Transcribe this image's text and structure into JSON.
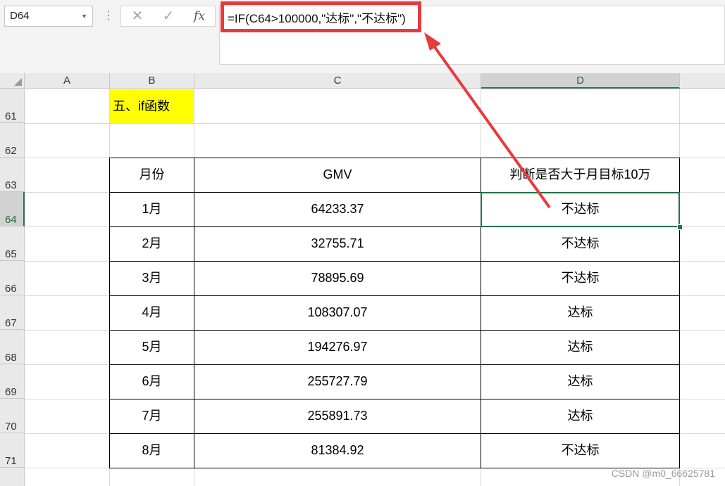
{
  "name_box": {
    "value": "D64"
  },
  "formula_bar": {
    "cancel_icon": "✕",
    "confirm_icon": "✓",
    "fx_label": "fx",
    "formula": "=IF(C64>100000,\"达标\",\"不达标\")"
  },
  "columns": [
    "A",
    "B",
    "C",
    "D"
  ],
  "rows": [
    "61",
    "62",
    "63",
    "64",
    "65",
    "66",
    "67",
    "68",
    "69",
    "70",
    "71"
  ],
  "selected_cell": "D64",
  "section_title": "五、if函数",
  "table": {
    "headers": [
      "月份",
      "GMV",
      "判断是否大于月目标10万"
    ],
    "rows": [
      {
        "month": "1月",
        "gmv": "64233.37",
        "result": "不达标"
      },
      {
        "month": "2月",
        "gmv": "32755.71",
        "result": "不达标"
      },
      {
        "month": "3月",
        "gmv": "78895.69",
        "result": "不达标"
      },
      {
        "month": "4月",
        "gmv": "108307.07",
        "result": "达标"
      },
      {
        "month": "5月",
        "gmv": "194276.97",
        "result": "达标"
      },
      {
        "month": "6月",
        "gmv": "255727.79",
        "result": "达标"
      },
      {
        "month": "7月",
        "gmv": "255891.73",
        "result": "达标"
      },
      {
        "month": "8月",
        "gmv": "81384.92",
        "result": "不达标"
      }
    ]
  },
  "annotation_color": "#e63b3d",
  "watermark": "CSDN @m0_66625781"
}
